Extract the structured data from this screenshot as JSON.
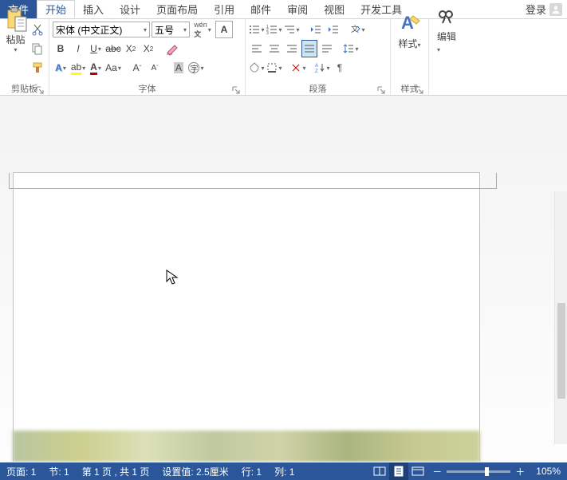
{
  "tabs": {
    "file": "文件",
    "home": "开始",
    "insert": "插入",
    "design": "设计",
    "layout": "页面布局",
    "references": "引用",
    "mail": "邮件",
    "review": "审阅",
    "view": "视图",
    "developer": "开发工具",
    "login": "登录"
  },
  "ribbon": {
    "clipboard": {
      "paste": "粘贴",
      "label": "剪贴板"
    },
    "font": {
      "font_name": "宋体  (中文正文)",
      "font_size": "五号",
      "label": "字体"
    },
    "paragraph": {
      "label": "段落"
    },
    "styles": {
      "btn": "样式",
      "label": "样式"
    },
    "editing": {
      "btn": "编辑"
    }
  },
  "status": {
    "page": "页面:  1",
    "section": "节:  1",
    "page_of": "第 1 页 , 共 1 页",
    "position": "设置值:  2.5厘米",
    "line": "行:  1",
    "column": "列:  1",
    "zoom": "105%"
  }
}
